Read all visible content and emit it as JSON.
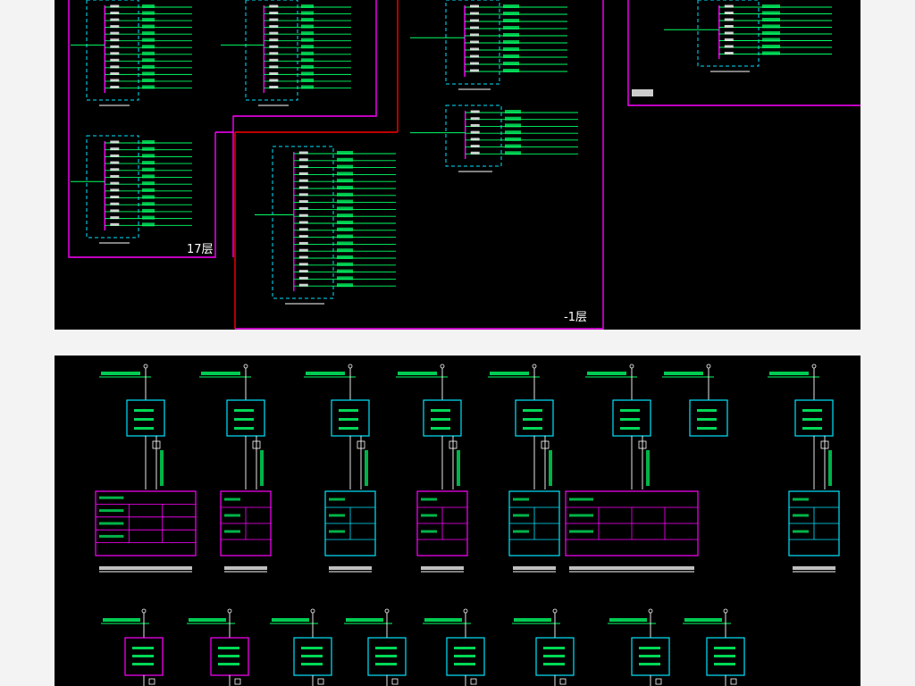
{
  "floor_labels": {
    "floor17": "17层",
    "basement": "-1层"
  },
  "colors": {
    "background": "#000000",
    "page": "#f3f3f3",
    "wire": "#00ff66",
    "panel_dash": "#00e5ff",
    "enclosure": "#ff00ff",
    "riser": "#ff2a2a",
    "box": "#00e5ff",
    "table_outline_alt": "#ff00ff"
  }
}
